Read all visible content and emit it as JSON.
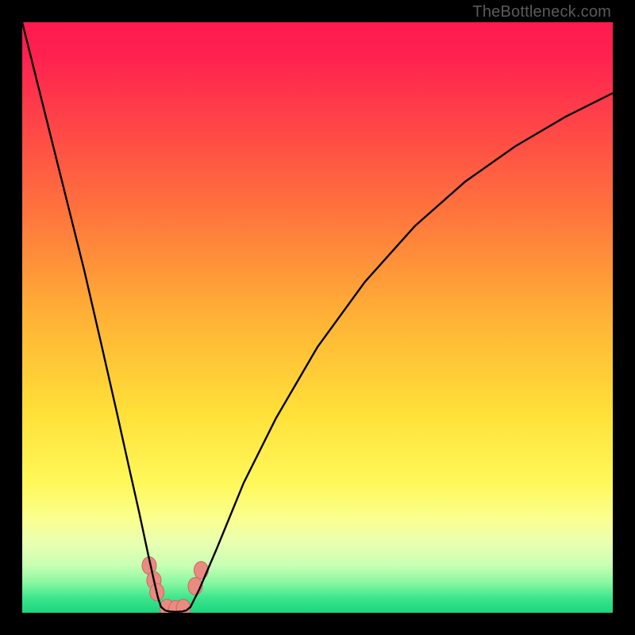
{
  "watermark": "TheBottleneck.com",
  "colors": {
    "frame_bg": "#000000",
    "gradient_stops": [
      {
        "offset": 0,
        "color": "#ff1a4d"
      },
      {
        "offset": 0.06,
        "color": "#ff2250"
      },
      {
        "offset": 0.18,
        "color": "#ff4747"
      },
      {
        "offset": 0.34,
        "color": "#ff7a3c"
      },
      {
        "offset": 0.5,
        "color": "#ffb236"
      },
      {
        "offset": 0.66,
        "color": "#ffe038"
      },
      {
        "offset": 0.78,
        "color": "#fff85a"
      },
      {
        "offset": 0.84,
        "color": "#fbff8e"
      },
      {
        "offset": 0.88,
        "color": "#eaffb0"
      },
      {
        "offset": 0.92,
        "color": "#c8ffb4"
      },
      {
        "offset": 0.95,
        "color": "#86f7a0"
      },
      {
        "offset": 0.975,
        "color": "#3de58d"
      },
      {
        "offset": 1.0,
        "color": "#19d67e"
      }
    ],
    "curve_stroke": "#000000",
    "blob_fill": "#e98b80",
    "blob_stroke": "#c96a5f"
  },
  "chart_data": {
    "type": "line",
    "title": "",
    "xlabel": "",
    "ylabel": "",
    "x_range": [
      0,
      100
    ],
    "y_range": [
      0,
      100
    ],
    "note": "Axes unlabeled in source image; values are relative percentages estimated from pixel positions. 0 is plot bottom/left, 100 is plot top/right.",
    "series": [
      {
        "name": "left-branch",
        "x": [
          0.0,
          2.0,
          4.5,
          7.5,
          10.5,
          13.5,
          16.0,
          18.0,
          19.8,
          21.3,
          22.3,
          23.0,
          23.5
        ],
        "y": [
          100,
          92,
          82,
          70,
          58,
          45,
          34,
          25,
          17,
          10,
          5.5,
          2.5,
          1.0
        ]
      },
      {
        "name": "valley-floor",
        "x": [
          23.5,
          24.2,
          25.0,
          26.0,
          27.0,
          27.8,
          28.5
        ],
        "y": [
          1.0,
          0.4,
          0.2,
          0.15,
          0.2,
          0.4,
          1.0
        ]
      },
      {
        "name": "right-branch",
        "x": [
          28.5,
          30.0,
          33.0,
          37.5,
          43.0,
          50.0,
          58.0,
          66.5,
          75.0,
          83.5,
          92.0,
          100.0
        ],
        "y": [
          1.0,
          4.0,
          11.0,
          22.0,
          33.0,
          45.0,
          56.0,
          65.5,
          73.0,
          79.0,
          84.0,
          88.0
        ]
      }
    ],
    "markers": {
      "description": "Pink blob markers clustered near the curve minimum.",
      "points": [
        {
          "x": 21.5,
          "y": 8.0
        },
        {
          "x": 22.3,
          "y": 5.5
        },
        {
          "x": 22.8,
          "y": 3.5
        },
        {
          "x": 24.5,
          "y": 0.8
        },
        {
          "x": 26.0,
          "y": 0.6
        },
        {
          "x": 27.3,
          "y": 0.8
        },
        {
          "x": 29.3,
          "y": 4.5
        },
        {
          "x": 30.3,
          "y": 7.2
        }
      ]
    }
  }
}
